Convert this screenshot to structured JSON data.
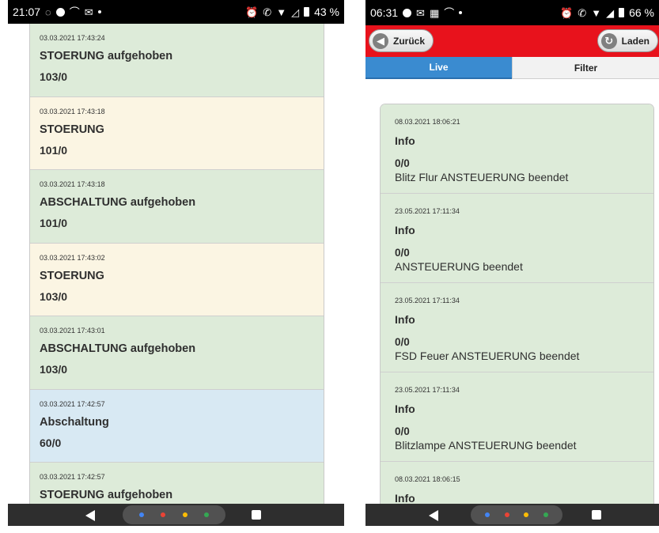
{
  "left_phone": {
    "status": {
      "time": "21:07",
      "battery": "43 %"
    },
    "items": [
      {
        "timestamp": "03.03.2021 17:43:24",
        "title": "STOERUNG aufgehoben",
        "code": "103/0",
        "color": "#ddebd9"
      },
      {
        "timestamp": "03.03.2021 17:43:18",
        "title": "STOERUNG",
        "code": "101/0",
        "color": "#fbf5e3"
      },
      {
        "timestamp": "03.03.2021 17:43:18",
        "title": "ABSCHALTUNG aufgehoben",
        "code": "101/0",
        "color": "#ddebd9"
      },
      {
        "timestamp": "03.03.2021 17:43:02",
        "title": "STOERUNG",
        "code": "103/0",
        "color": "#fbf5e3"
      },
      {
        "timestamp": "03.03.2021 17:43:01",
        "title": "ABSCHALTUNG aufgehoben",
        "code": "103/0",
        "color": "#ddebd9"
      },
      {
        "timestamp": "03.03.2021 17:42:57",
        "title": "Abschaltung",
        "code": "60/0",
        "color": "#d8e9f3"
      },
      {
        "timestamp": "03.03.2021 17:42:57",
        "title": "STOERUNG aufgehoben",
        "code": "",
        "color": "#ddebd9"
      }
    ]
  },
  "right_phone": {
    "status": {
      "time": "06:31",
      "battery": "66 %"
    },
    "header": {
      "back_label": "Zurück",
      "reload_label": "Laden",
      "color": "#e8121c"
    },
    "tabs": [
      {
        "label": "Live",
        "active": true
      },
      {
        "label": "Filter",
        "active": false
      }
    ],
    "items": [
      {
        "timestamp": "08.03.2021 18:06:21",
        "title": "Info",
        "code": "0/0",
        "message": "Blitz Flur ANSTEUERUNG beendet"
      },
      {
        "timestamp": "23.05.2021 17:11:34",
        "title": "Info",
        "code": "0/0",
        "message": "ANSTEUERUNG beendet"
      },
      {
        "timestamp": "23.05.2021 17:11:34",
        "title": "Info",
        "code": "0/0",
        "message": "FSD Feuer ANSTEUERUNG beendet"
      },
      {
        "timestamp": "23.05.2021 17:11:34",
        "title": "Info",
        "code": "0/0",
        "message": "Blitzlampe ANSTEUERUNG beendet"
      },
      {
        "timestamp": "08.03.2021 18:06:15",
        "title": "Info",
        "code": "",
        "message": ""
      }
    ]
  },
  "icons": {
    "back_arrow": "◀",
    "reload": "↻"
  },
  "nav_colors": [
    "#4285f4",
    "#ea4335",
    "#fbbc05",
    "#34a853"
  ]
}
